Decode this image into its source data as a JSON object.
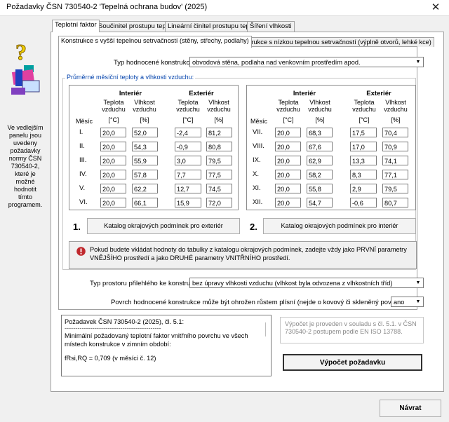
{
  "window": {
    "title": "Požadavky ČSN 730540-2 'Tepelná ochrana budov' (2025)",
    "close_glyph": "✕"
  },
  "sidebar": {
    "icon": "help-book-icon",
    "info": "Ve vedlejším panelu jsou uvedeny požadavky normy ČSN 730540-2, které je možné hodnotit tímto programem."
  },
  "tabs": [
    "Teplotní faktor",
    "Součinitel prostupu tepla",
    "Lineární činitel prostupu tepla",
    "Šíření vlhkosti"
  ],
  "subtabs": [
    "Konstrukce s vyšší tepelnou setrvačností (stěny, střechy, podlahy)",
    "Konstrukce s nízkou tepelnou setrvačností (výplně otvorů, lehké kce)"
  ],
  "construction": {
    "label": "Typ hodnocené konstrukce:",
    "value": "obvodová stěna, podlaha nad venkovním prostředím apod."
  },
  "group": {
    "title": "Průměrné měsíční teploty a vlhkosti vzduchu:",
    "month_label": "Měsíc",
    "interior": "Interiér",
    "exterior": "Exteriér",
    "col_temp": "Teplota vzduchu",
    "col_hum": "Vlhkost vzduchu",
    "unit_temp": "[°C]",
    "unit_hum": "[%]",
    "left_rows": [
      {
        "month": "I.",
        "ti": "20,0",
        "hi": "52,0",
        "te": "-2,4",
        "he": "81,2"
      },
      {
        "month": "II.",
        "ti": "20,0",
        "hi": "54,3",
        "te": "-0,9",
        "he": "80,8"
      },
      {
        "month": "III.",
        "ti": "20,0",
        "hi": "55,9",
        "te": "3,0",
        "he": "79,5"
      },
      {
        "month": "IV.",
        "ti": "20,0",
        "hi": "57,8",
        "te": "7,7",
        "he": "77,5"
      },
      {
        "month": "V.",
        "ti": "20,0",
        "hi": "62,2",
        "te": "12,7",
        "he": "74,5"
      },
      {
        "month": "VI.",
        "ti": "20,0",
        "hi": "66,1",
        "te": "15,9",
        "he": "72,0"
      }
    ],
    "right_rows": [
      {
        "month": "VII.",
        "ti": "20,0",
        "hi": "68,3",
        "te": "17,5",
        "he": "70,4"
      },
      {
        "month": "VIII.",
        "ti": "20,0",
        "hi": "67,6",
        "te": "17,0",
        "he": "70,9"
      },
      {
        "month": "IX.",
        "ti": "20,0",
        "hi": "62,9",
        "te": "13,3",
        "he": "74,1"
      },
      {
        "month": "X.",
        "ti": "20,0",
        "hi": "58,2",
        "te": "8,3",
        "he": "77,1"
      },
      {
        "month": "XI.",
        "ti": "20,0",
        "hi": "55,8",
        "te": "2,9",
        "he": "79,5"
      },
      {
        "month": "XII.",
        "ti": "20,0",
        "hi": "54,7",
        "te": "-0,6",
        "he": "80,7"
      }
    ],
    "num1": "1.",
    "num2": "2.",
    "btn_exterior": "Katalog okrajových podmínek pro exteriér",
    "btn_interior": "Katalog okrajových podmínek pro interiér",
    "warning": "Pokud budete vkládat hodnoty do tabulky z katalogu okrajových podmínek, zadejte vždy jako PRVNÍ parametry VNĚJŠÍHO prostředí a jako DRUHÉ parametry VNITŘNÍHO prostředí."
  },
  "room_type": {
    "label": "Typ prostoru přilehlého ke konstrukci:",
    "value": "bez úpravy vlhkosti vzduchu (vlhkost byla odvozena z vlhkostních tříd)"
  },
  "mould": {
    "label": "Povrch hodnocené konstrukce může být ohrožen růstem plísní (nejde o kovový či skleněný povrch):",
    "value": "ano"
  },
  "result": {
    "line1": "Požadavek ČSN 730540-2 (2025), čl. 5.1:",
    "line2": "---------------------------------------------",
    "line3": "Minimální požadovaný teplotní faktor vnitřního povrchu ve všech místech konstrukce v zimním období:",
    "line4": "fRsi,RQ = 0,709   (v měsíci č. 12)"
  },
  "note": "Výpočet je proveden v souladu s čl. 5.1. v ČSN 730540-2 postupem podle EN ISO 13788.",
  "calc_button": "Výpočet požadavku",
  "back_button": "Návrat"
}
